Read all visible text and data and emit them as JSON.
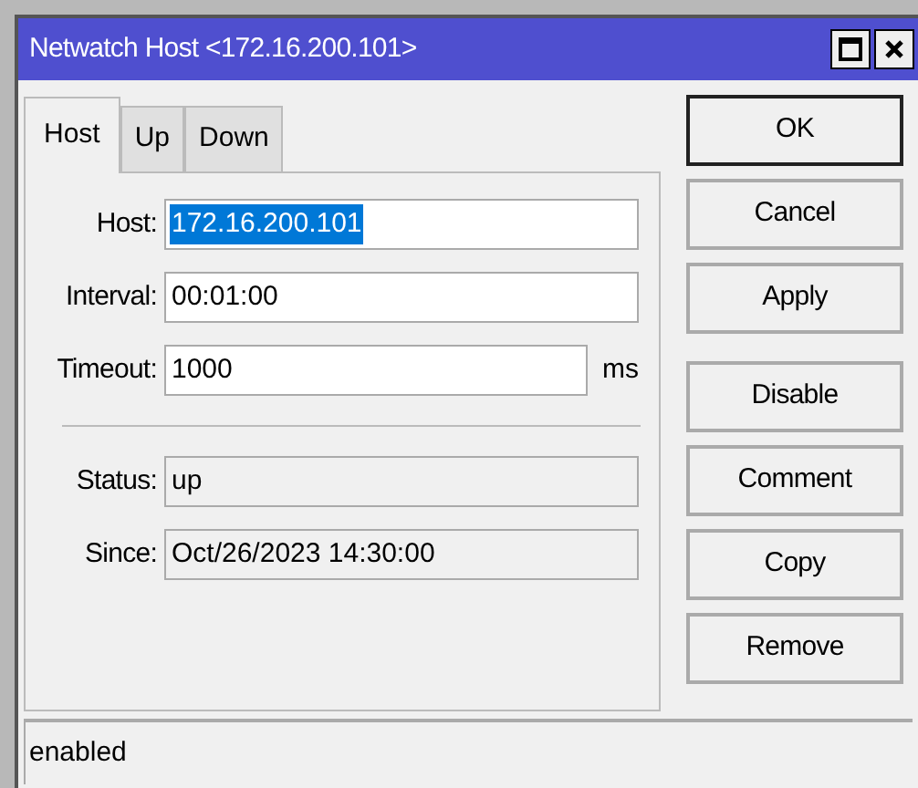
{
  "window": {
    "title": "Netwatch Host <172.16.200.101>"
  },
  "tabs": [
    {
      "label": "Host",
      "selected": true
    },
    {
      "label": "Up",
      "selected": false
    },
    {
      "label": "Down",
      "selected": false
    }
  ],
  "fields": [
    {
      "label": "Host:",
      "value": "172.16.200.101",
      "kind": "editable",
      "selected": true
    },
    {
      "label": "Interval:",
      "value": "00:01:00",
      "kind": "editable",
      "selected": false
    },
    {
      "label": "Timeout:",
      "value": "1000",
      "kind": "editable",
      "selected": false,
      "unit": "ms"
    },
    {
      "kind": "separator"
    },
    {
      "label": "Status:",
      "value": "up",
      "kind": "readonly",
      "selected": false
    },
    {
      "label": "Since:",
      "value": "Oct/26/2023 14:30:00",
      "kind": "readonly",
      "selected": false
    }
  ],
  "buttons": [
    {
      "label": "OK",
      "default": true
    },
    {
      "label": "Cancel",
      "default": false
    },
    {
      "label": "Apply",
      "default": false
    },
    {
      "kind": "gap"
    },
    {
      "label": "Disable",
      "default": false
    },
    {
      "label": "Comment",
      "default": false
    },
    {
      "label": "Copy",
      "default": false
    },
    {
      "label": "Remove",
      "default": false
    }
  ],
  "status_bar": "enabled"
}
